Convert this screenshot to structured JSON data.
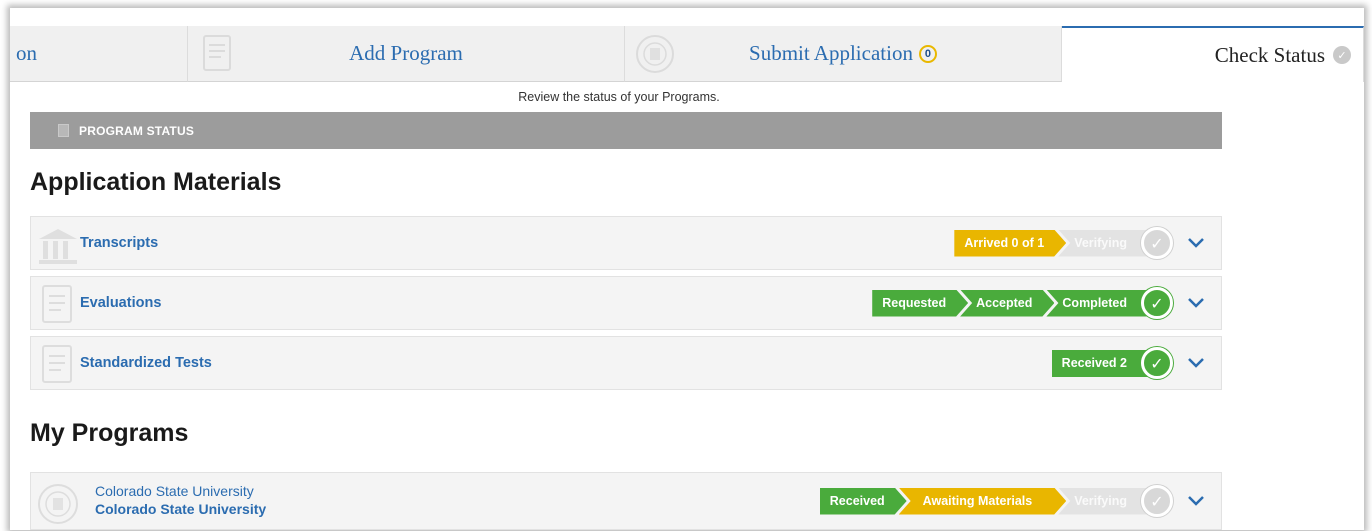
{
  "tabs": {
    "partial_label": "on",
    "add_program": "Add Program",
    "submit_application": "Submit Application",
    "submit_badge": "0",
    "check_status": "Check Status"
  },
  "review_text": "Review the status of your Programs.",
  "status_bar": {
    "label": "PROGRAM STATUS"
  },
  "application_materials": {
    "title": "Application Materials",
    "rows": [
      {
        "label": "Transcripts",
        "icon": "institution-icon",
        "steps": [
          "Arrived 0 of 1",
          "Verifying"
        ],
        "step_colors": [
          "#e9b600",
          "#e3e3e3"
        ],
        "complete": false
      },
      {
        "label": "Evaluations",
        "icon": "document-icon",
        "steps": [
          "Requested",
          "Accepted",
          "Completed"
        ],
        "step_colors": [
          "#4aab3c",
          "#4aab3c",
          "#4aab3c"
        ],
        "complete": true
      },
      {
        "label": "Standardized Tests",
        "icon": "document-icon",
        "steps": [
          "Received 2"
        ],
        "step_colors": [
          "#4aab3c"
        ],
        "complete": true
      }
    ]
  },
  "my_programs": {
    "title": "My Programs",
    "rows": [
      {
        "line1": "Colorado State University",
        "line2": "Colorado State University",
        "icon": "seal-icon",
        "steps": [
          "Received",
          "Awaiting Materials",
          "Verifying"
        ],
        "step_colors": [
          "#4aab3c",
          "#e9b600",
          "#e3e3e3"
        ],
        "complete": false
      }
    ]
  },
  "colors": {
    "link": "#2b6cb0",
    "green": "#4aab3c",
    "yellow": "#e9b600",
    "gray": "#e3e3e3",
    "bar": "#9c9c9c"
  }
}
